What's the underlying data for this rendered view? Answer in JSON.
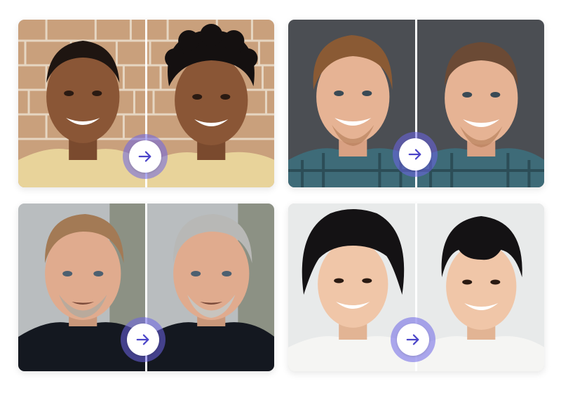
{
  "cards": [
    {
      "id": "curly-hair",
      "before": "short-fade-hair",
      "after": "curly-hair",
      "arrow": "arrow-right-icon"
    },
    {
      "id": "buzz-cut",
      "before": "wavy-brown-hair",
      "after": "buzz-cut-hair",
      "arrow": "arrow-right-icon"
    },
    {
      "id": "gray-hair",
      "before": "light-brown-hair",
      "after": "gray-hair",
      "arrow": "arrow-right-icon"
    },
    {
      "id": "short-black-hair",
      "before": "wavy-black-hair",
      "after": "short-black-hair",
      "arrow": "arrow-right-icon"
    }
  ],
  "colors": {
    "accent_ring": "#7a72e6",
    "arrow": "#4b45c9",
    "divider": "#ffffff"
  }
}
